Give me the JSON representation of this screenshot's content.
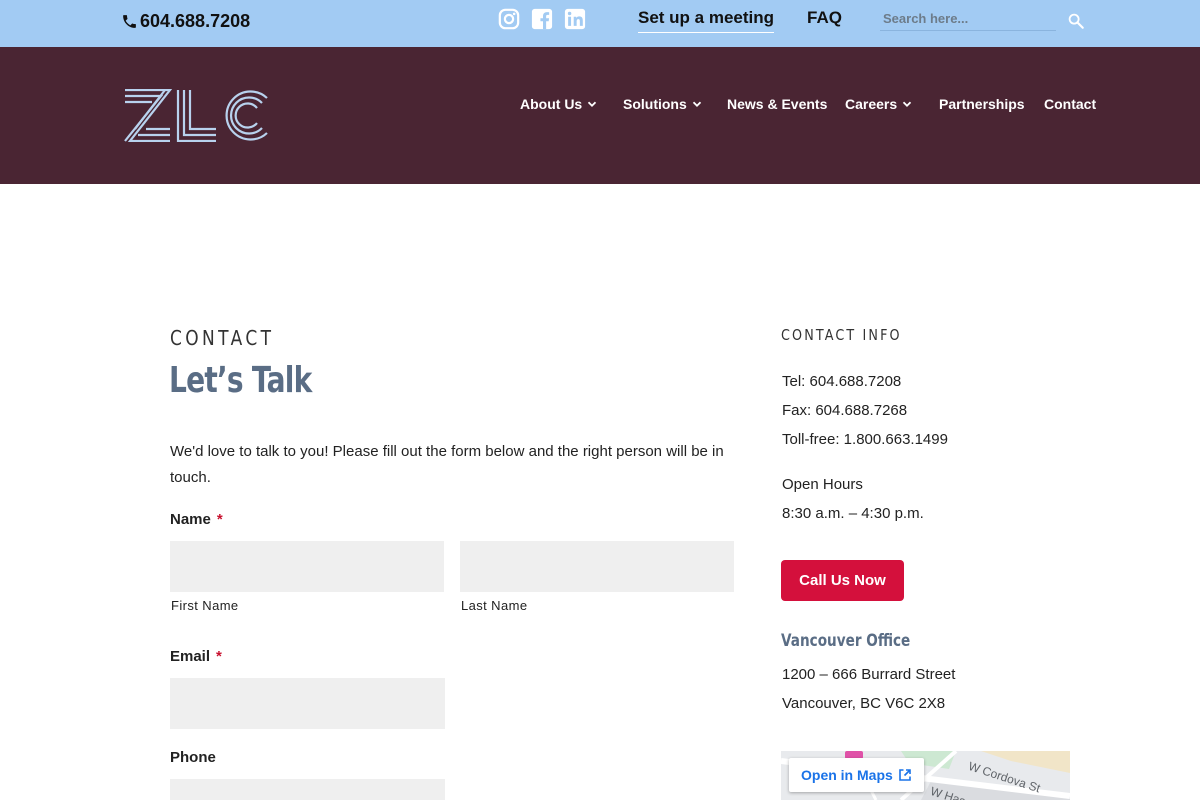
{
  "topbar": {
    "phone": "604.688.7208",
    "social": [
      "instagram-icon",
      "facebook-icon",
      "linkedin-icon"
    ],
    "meeting_label": "Set up a meeting",
    "faq_label": "FAQ",
    "search_placeholder": "Search here..."
  },
  "header": {
    "logo_text": "ZLC",
    "nav": [
      {
        "label": "About Us",
        "dropdown": true
      },
      {
        "label": "Solutions",
        "dropdown": true
      },
      {
        "label": "News & Events",
        "dropdown": false
      },
      {
        "label": "Careers",
        "dropdown": true
      },
      {
        "label": "Partnerships",
        "dropdown": false
      },
      {
        "label": "Contact",
        "dropdown": false
      }
    ]
  },
  "main": {
    "eyebrow": "CONTACT",
    "headline": "Let’s Talk",
    "intro": "We'd love to talk to you! Please fill out the form below and the right person will be in touch.",
    "form": {
      "name_label": "Name",
      "required_mark": "*",
      "first_name_label": "First Name",
      "last_name_label": "Last Name",
      "first_name_value": "",
      "last_name_value": "",
      "email_label": "Email",
      "email_value": "",
      "phone_label": "Phone",
      "phone_value": ""
    }
  },
  "sidebar": {
    "title": "CONTACT INFO",
    "tel": "Tel: 604.688.7208",
    "fax": "Fax: 604.688.7268",
    "tollfree": "Toll-free: 1.800.663.1499",
    "hours_label": "Open Hours",
    "hours": "8:30 a.m. – 4:30 p.m.",
    "call_button": "Call Us Now",
    "office_title": "Vancouver Office",
    "address_line1": "1200 – 666 Burrard Street",
    "address_line2": "Vancouver, BC V6C 2X8",
    "map": {
      "open_label": "Open in Maps",
      "street1": "W Cordova St",
      "street2": "W Has"
    }
  },
  "colors": {
    "topbar": "#a2cbf3",
    "header": "#4a2533",
    "accent": "#d4103c",
    "heading": "#5a6d85"
  }
}
